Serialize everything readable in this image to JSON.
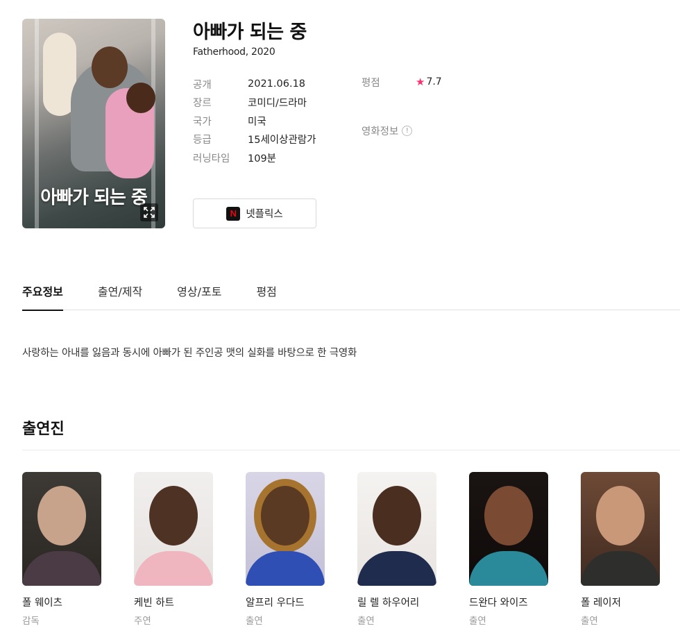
{
  "movie": {
    "title": "아빠가 되는 중",
    "subtitle": "Fatherhood, 2020",
    "poster_title": "아빠가 되는 중"
  },
  "info": {
    "rows": [
      {
        "label": "공개",
        "value": "2021.06.18"
      },
      {
        "label": "장르",
        "value": "코미디/드라마"
      },
      {
        "label": "국가",
        "value": "미국"
      },
      {
        "label": "등급",
        "value": "15세이상관람가"
      },
      {
        "label": "러닝타임",
        "value": "109분"
      }
    ],
    "rating_label": "평점",
    "rating_value": "7.7",
    "rating_star_color": "#ff2f6e",
    "movie_info_label": "영화정보",
    "movie_info_icon": "!"
  },
  "netflix_button": {
    "label": "넷플릭스",
    "logo_letter": "N",
    "logo_color": "#e50914"
  },
  "tabs": [
    {
      "label": "주요정보",
      "active": true
    },
    {
      "label": "출연/제작",
      "active": false
    },
    {
      "label": "영상/포토",
      "active": false
    },
    {
      "label": "평점",
      "active": false
    }
  ],
  "synopsis": "사랑하는 아내를 잃음과 동시에 아빠가 된 주인공 맷의 실화를 바탕으로 한 극영화",
  "cast": {
    "heading": "출연진",
    "members": [
      {
        "name": "폴 웨이츠",
        "role": "감독"
      },
      {
        "name": "케빈 하트",
        "role": "주연"
      },
      {
        "name": "알프리 우다드",
        "role": "출연"
      },
      {
        "name": "릴 렐 하우어리",
        "role": "출연"
      },
      {
        "name": "드완다 와이즈",
        "role": "출연"
      },
      {
        "name": "폴 레이저",
        "role": "출연"
      }
    ]
  }
}
